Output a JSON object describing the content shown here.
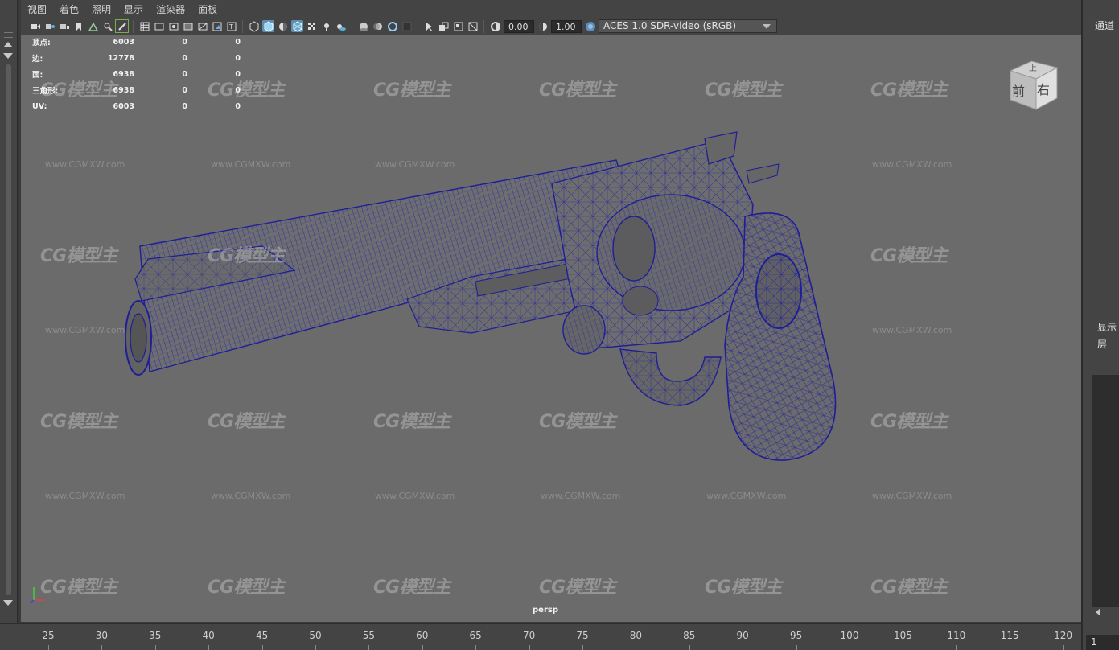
{
  "menu": [
    "视图",
    "着色",
    "照明",
    "显示",
    "渲染器",
    "面板"
  ],
  "toolbar": {
    "exposure_value": "0.00",
    "gamma_value": "1.00",
    "color_space": "ACES 1.0 SDR-video (sRGB)",
    "icons": [
      "camera-icon",
      "camera-attributes-icon",
      "bookmark-icon",
      "image-plane-icon",
      "grid-icon",
      "film-gate-icon",
      "resolution-gate-icon",
      "gate-mask-icon",
      "field-chart-icon",
      "safe-action-icon",
      "safe-title-icon",
      "wireframe-icon",
      "smooth-shade-icon",
      "flat-shade-icon",
      "wireframe-on-shaded-icon",
      "textured-icon",
      "use-all-lights-icon",
      "shadows-icon",
      "screen-space-ao-icon",
      "motion-blur-icon",
      "anti-aliasing-icon",
      "depth-of-field-icon",
      "isolate-select-icon",
      "xray-icon",
      "xray-joints-icon",
      "backface-icon"
    ]
  },
  "hud": {
    "rows": [
      {
        "label": "顶点:",
        "v1": "6003",
        "v2": "0",
        "v3": "0"
      },
      {
        "label": "边:",
        "v1": "12778",
        "v2": "0",
        "v3": "0"
      },
      {
        "label": "面:",
        "v1": "6938",
        "v2": "0",
        "v3": "0"
      },
      {
        "label": "三角形:",
        "v1": "6938",
        "v2": "0",
        "v3": "0"
      },
      {
        "label": "UV:",
        "v1": "6003",
        "v2": "0",
        "v3": "0"
      }
    ]
  },
  "viewport": {
    "camera": "persp",
    "viewcube": {
      "front": "前",
      "right": "右",
      "top": "上"
    },
    "wireframe_color": "#1e1e96",
    "background_color": "#6b6b6b"
  },
  "watermark": {
    "logo": "CG模型主",
    "url": "www.CGMXW.com"
  },
  "right_panel": {
    "channels": "通道",
    "display": "显示",
    "layer": "层",
    "frame": "1"
  },
  "timeline": {
    "labels": [
      "25",
      "30",
      "35",
      "40",
      "45",
      "50",
      "55",
      "60",
      "65",
      "70",
      "75",
      "80",
      "85",
      "90",
      "95",
      "100",
      "105",
      "110",
      "115",
      "120"
    ]
  }
}
